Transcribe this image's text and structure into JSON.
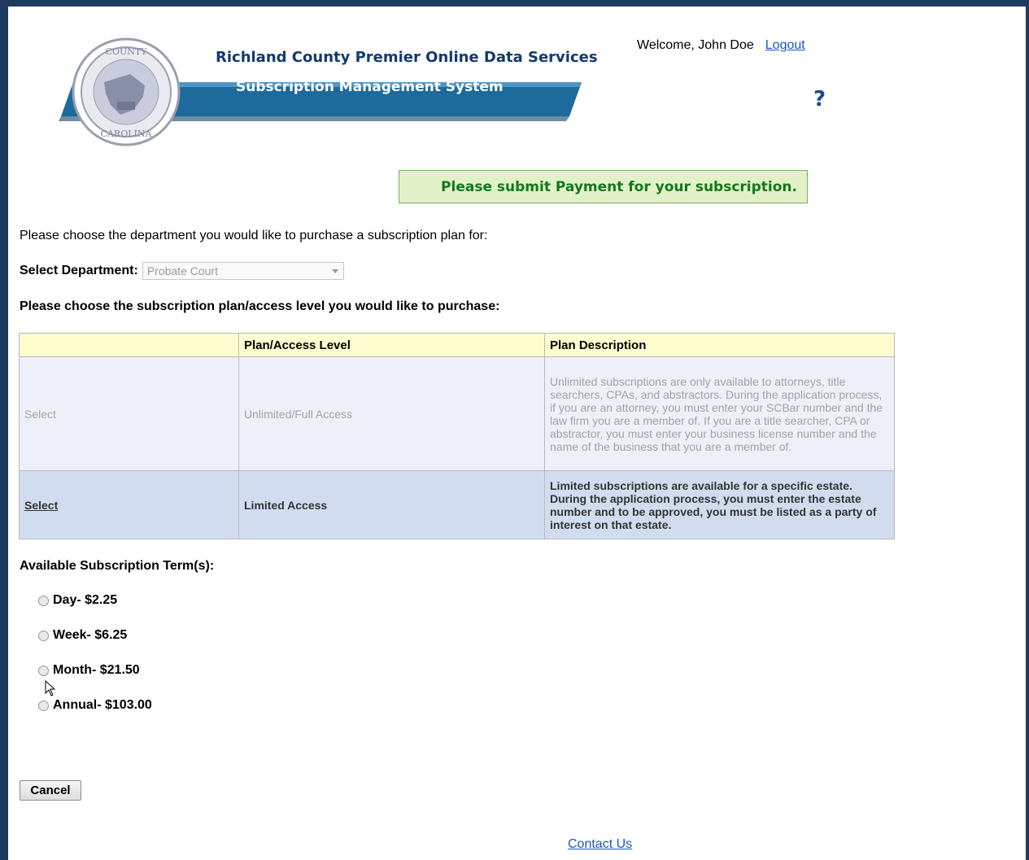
{
  "header": {
    "title_main": "Richland County Premier Online Data Services",
    "title_sub": "Subscription Management System",
    "welcome_text": "Welcome, John Doe",
    "logout_label": "Logout",
    "help_icon": "?",
    "seal_icon": "county-seal-icon"
  },
  "notice": {
    "text": "Please submit Payment for your subscription."
  },
  "department": {
    "intro": "Please choose the department you would like to purchase a subscription plan for:",
    "label": "Select Department:",
    "selected": "Probate Court"
  },
  "plans": {
    "heading": "Please choose the subscription plan/access level you would like to purchase:",
    "columns": [
      "",
      "Plan/Access Level",
      "Plan Description"
    ],
    "rows": [
      {
        "select": "Select",
        "level": "Unlimited/Full Access",
        "description": "Unlimited subscriptions are only available to attorneys, title searchers, CPAs, and abstractors. During the application process, if you are an attorney, you must enter your SCBar number and the law firm you are a member of. If you are a title searcher, CPA or abstractor, you must enter your business license number and the name of the business that you are a member of."
      },
      {
        "select": "Select",
        "level": "Limited Access",
        "description": "Limited subscriptions are available for a specific estate. During the application process, you must enter the estate number and to be approved, you must be listed as a party of interest on that estate."
      }
    ]
  },
  "terms": {
    "heading": "Available Subscription Term(s):",
    "options": [
      "Day- $2.25",
      "Week- $6.25",
      "Month- $21.50",
      "Annual- $103.00"
    ]
  },
  "actions": {
    "cancel_label": "Cancel"
  },
  "footer": {
    "contact_label": "Contact Us"
  },
  "colors": {
    "frame_border": "#1f3a5f",
    "banner_blue": "#1d6a9c",
    "notice_bg": "#e3f1c9",
    "notice_text": "#13781b",
    "table_header": "#fdfdcf",
    "active_row": "#d1ddef"
  }
}
